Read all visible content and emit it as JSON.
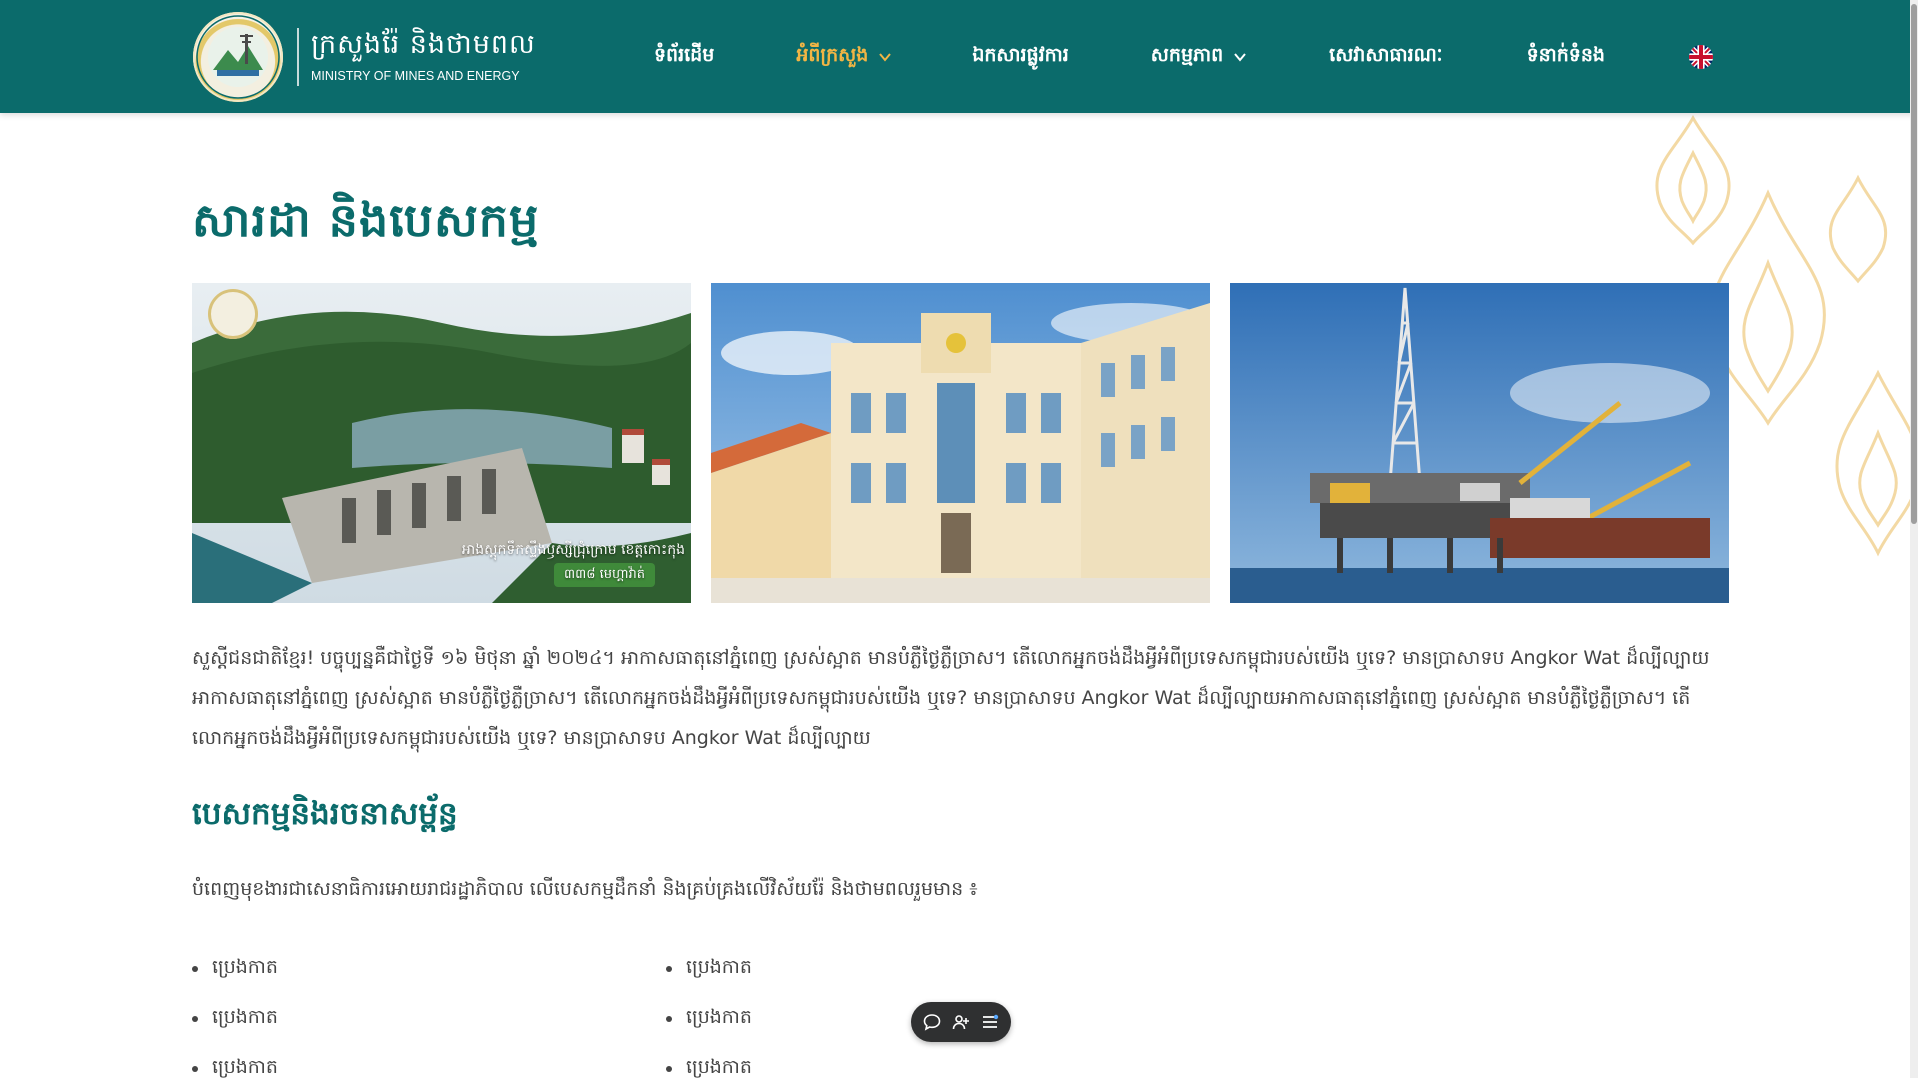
{
  "header": {
    "logo_kh": "ក្រសួងរ៉ែ និងថាមពល",
    "logo_en": "MINISTRY OF MINES AND ENERGY",
    "nav": [
      {
        "label": "ទំព័រដើម",
        "has_dropdown": false,
        "active": false
      },
      {
        "label": "អំពីក្រសួង",
        "has_dropdown": true,
        "active": true
      },
      {
        "label": "ឯកសារផ្លូវការ",
        "has_dropdown": false,
        "active": false
      },
      {
        "label": "សកម្មភាព",
        "has_dropdown": true,
        "active": false
      },
      {
        "label": "សេវាសាធារណៈ",
        "has_dropdown": false,
        "active": false
      },
      {
        "label": "ទំនាក់ទំនង",
        "has_dropdown": false,
        "active": false
      }
    ],
    "language_icon": "uk-flag-icon"
  },
  "main": {
    "title": "សារដា និងបេសកម្ម",
    "images": [
      {
        "name": "dam-image",
        "caption": "អាងស្តុកទឹកស្ទឹងឫស្សីជ្រុំក្រោម ខេត្តកោះកុង",
        "caption_sub": "៣៣៨ មេហ្គាវ៉ាត់"
      },
      {
        "name": "ministry-building-image"
      },
      {
        "name": "oil-rig-image"
      }
    ],
    "intro": "សួស្តីជនជាតិខ្មែរ! បច្ចុប្បន្នគឺជាថ្ងៃទី ១៦ មិថុនា ឆ្នាំ ២០២៤។ អាកាសធាតុនៅភ្នំពេញ ស្រស់ស្អាត មានបំភ្លឺថ្ងៃភ្លឺច្រាស។ តើលោកអ្នកចង់ដឹងអ្វីអំពីប្រទេសកម្ពុជារបស់យើង ឬទេ? មានប្រាសាទប Angkor Wat ដ៏ល្បីល្បាយ អាកាសធាតុនៅភ្នំពេញ ស្រស់ស្អាត មានបំភ្លឺថ្ងៃភ្លឺច្រាស។ តើលោកអ្នកចង់ដឹងអ្វីអំពីប្រទេសកម្ពុជារបស់យើង ឬទេ? មានប្រាសាទប Angkor Wat ដ៏ល្បីល្បាយអាកាសធាតុនៅភ្នំពេញ ស្រស់ស្អាត មានបំភ្លឺថ្ងៃភ្លឺច្រាស។ តើលោកអ្នកចង់ដឹងអ្វីអំពីប្រទេសកម្ពុជារបស់យើង ឬទេ? មានប្រាសាទប Angkor Wat ដ៏ល្បីល្បាយ",
    "section_title": "បេសកម្មនិងរចនាសម្ព័ន្ធ",
    "section_desc": "បំពេញមុខងារជាសេនាធិការអោយរាជរដ្ឋាភិបាល លើបេសកម្មដឹកនាំ និងគ្រប់គ្រងលើវិស័យរ៉ែ និងថាមពលរួមមាន ៖",
    "list_items": [
      "ប្រេងកាត",
      "ប្រេងកាត",
      "ប្រេងកាត",
      "ប្រេងកាត",
      "ប្រេងកាត",
      "ប្រេងកាត"
    ]
  },
  "toolbar": {
    "icons": [
      "chat-icon",
      "add-user-icon",
      "menu-list-icon"
    ]
  },
  "colors": {
    "header_bg": "#0b6b6b",
    "accent": "#f2b544",
    "title": "#0b6b6b"
  }
}
